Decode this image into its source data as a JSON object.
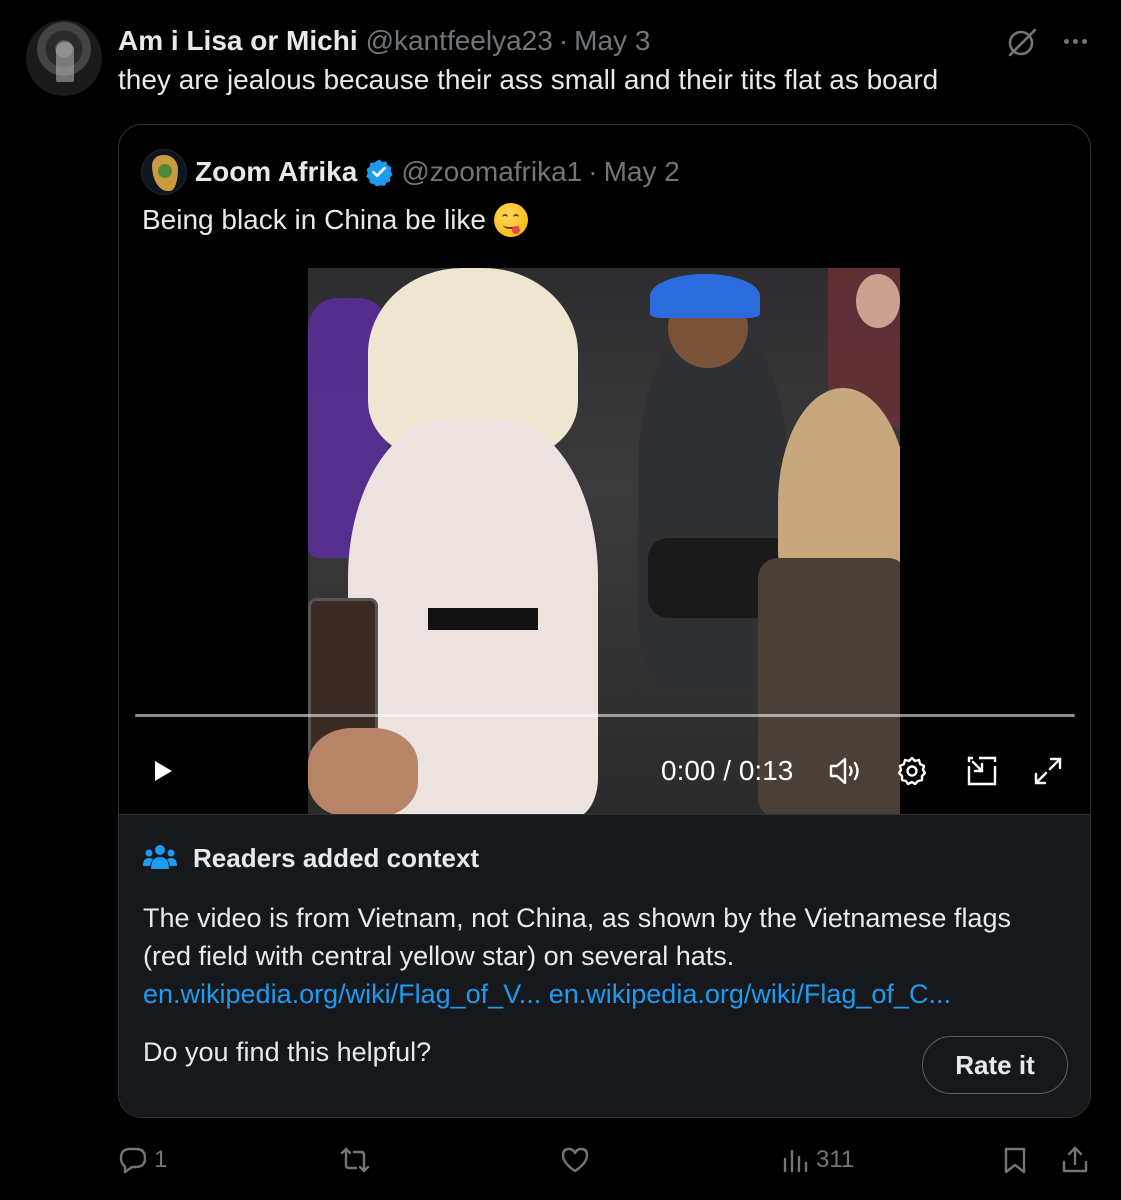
{
  "tweet": {
    "author_name": "Am i Lisa or Michi",
    "author_handle": "@kantfeelya23",
    "separator": "·",
    "date": "May 3",
    "text": "they are jealous because their ass small and their tits flat as board"
  },
  "quoted_tweet": {
    "author_name": "Zoom Afrika",
    "author_handle": "@zoomafrika1",
    "separator": "·",
    "date": "May 2",
    "verified": true,
    "text": "Being black in China be like",
    "emoji": "yum-face-emoji"
  },
  "video": {
    "time_label": "0:00 / 0:13",
    "progress": 0,
    "controls": [
      "play-icon",
      "volume-icon",
      "settings-icon",
      "pip-icon",
      "fullscreen-icon"
    ]
  },
  "community_note": {
    "title": "Readers added context",
    "body": "The video is from Vietnam, not China, as shown by the Vietnamese flags (red field with central yellow star) on several hats.",
    "links": [
      "en.wikipedia.org/wiki/Flag_of_V...",
      "en.wikipedia.org/wiki/Flag_of_C..."
    ],
    "question": "Do you find this helpful?",
    "rate_label": "Rate it"
  },
  "actions": {
    "reply_count": "1",
    "retweet_count": "",
    "like_count": "",
    "views_count": "311"
  },
  "colors": {
    "background": "#000000",
    "text": "#e7e9ea",
    "muted": "#71767b",
    "accent": "#1d9bf0",
    "note_bg": "#16181c",
    "border": "#2f3336"
  }
}
